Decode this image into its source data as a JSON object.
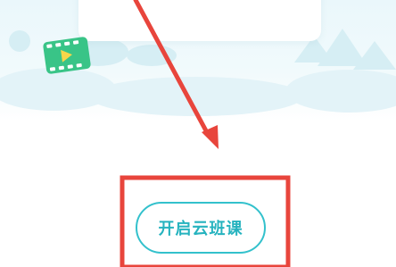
{
  "cta": {
    "label": "开启云班课"
  },
  "icons": {
    "video": "video-play-icon",
    "arrow": "red-arrow-annotation",
    "highlight": "red-highlight-box"
  },
  "colors": {
    "accent": "#26b3bf",
    "annotation": "#e8453c",
    "hero_bg": "#eaf7fb",
    "badge": "#39c487"
  }
}
